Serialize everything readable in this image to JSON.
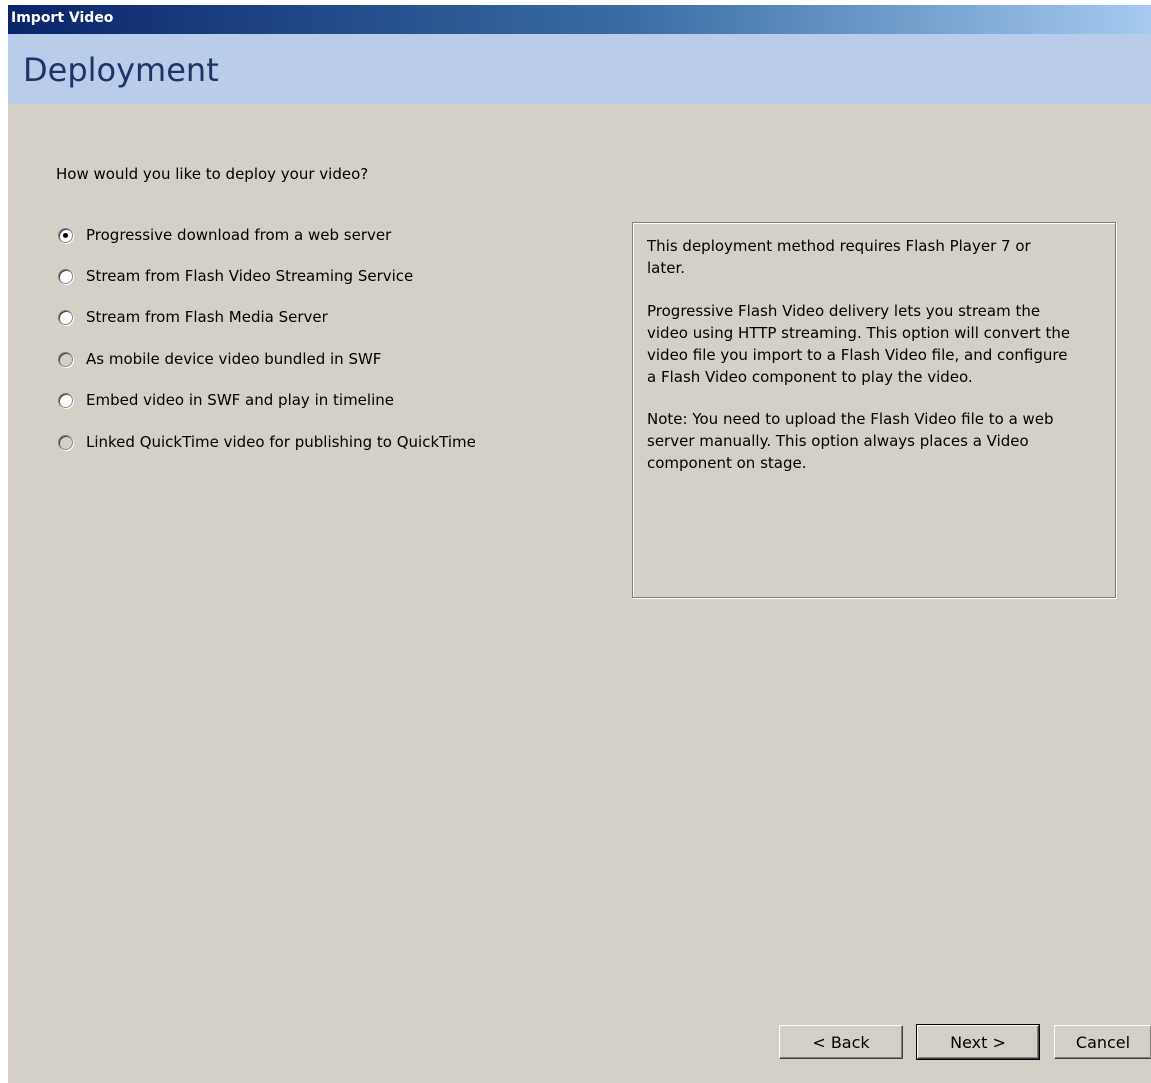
{
  "window": {
    "title": "Import Video",
    "banner_title": "Deployment"
  },
  "main": {
    "question": "How would you like to deploy your video?",
    "options": [
      {
        "label": "Progressive download from a web server",
        "selected": true,
        "enabled": true
      },
      {
        "label": "Stream from Flash Video Streaming Service",
        "selected": false,
        "enabled": true
      },
      {
        "label": "Stream from Flash Media Server",
        "selected": false,
        "enabled": true
      },
      {
        "label": "As mobile device video bundled in SWF",
        "selected": false,
        "enabled": false
      },
      {
        "label": "Embed video in SWF and play in timeline",
        "selected": false,
        "enabled": true
      },
      {
        "label": "Linked QuickTime video for publishing to QuickTime",
        "selected": false,
        "enabled": false
      }
    ],
    "info": {
      "paragraph1": "This deployment method requires Flash Player 7 or\nlater.",
      "paragraph2": "Progressive Flash Video delivery lets you stream the\nvideo using HTTP streaming. This option will convert the\nvideo file you import to a Flash Video file, and configure\na Flash Video component to play the video.",
      "paragraph3": "Note: You need to upload the Flash Video file to a web\nserver manually.  This option always places a Video\ncomponent on stage."
    }
  },
  "footer": {
    "back_label": "< Back",
    "next_label": "Next >",
    "cancel_label": "Cancel"
  }
}
